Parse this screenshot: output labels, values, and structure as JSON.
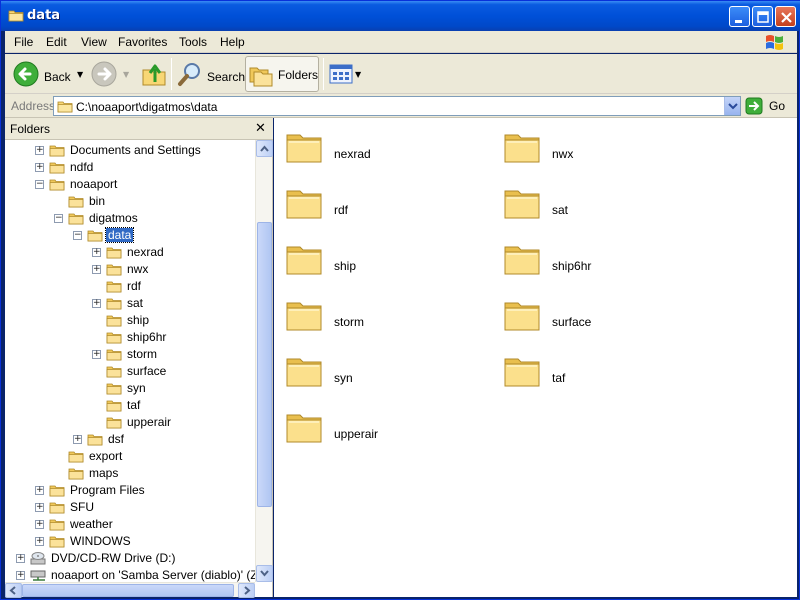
{
  "window": {
    "title": "data",
    "icon": "folder-icon"
  },
  "menu": {
    "items": [
      {
        "label": "File",
        "key": "F"
      },
      {
        "label": "Edit",
        "key": "E"
      },
      {
        "label": "View",
        "key": "V"
      },
      {
        "label": "Favorites",
        "key": "a"
      },
      {
        "label": "Tools",
        "key": "T"
      },
      {
        "label": "Help",
        "key": "H"
      }
    ]
  },
  "toolbar": {
    "back_label": "Back",
    "search_label": "Search",
    "folders_label": "Folders"
  },
  "address": {
    "label": "Address",
    "path": "C:\\noaaport\\digatmos\\data",
    "go_label": "Go"
  },
  "folder_pane": {
    "title": "Folders",
    "close_glyph": "✕",
    "tree": [
      {
        "label": "Documents and Settings",
        "expander": "+"
      },
      {
        "label": "ndfd",
        "expander": "+"
      },
      {
        "label": "noaaport",
        "expander": "−"
      },
      {
        "label": "bin",
        "expander": ""
      },
      {
        "label": "digatmos",
        "expander": "−"
      },
      {
        "label": "data",
        "expander": "−",
        "selected": true
      },
      {
        "label": "nexrad",
        "expander": "+"
      },
      {
        "label": "nwx",
        "expander": "+"
      },
      {
        "label": "rdf",
        "expander": ""
      },
      {
        "label": "sat",
        "expander": "+"
      },
      {
        "label": "ship",
        "expander": ""
      },
      {
        "label": "ship6hr",
        "expander": ""
      },
      {
        "label": "storm",
        "expander": "+"
      },
      {
        "label": "surface",
        "expander": ""
      },
      {
        "label": "syn",
        "expander": ""
      },
      {
        "label": "taf",
        "expander": ""
      },
      {
        "label": "upperair",
        "expander": ""
      },
      {
        "label": "dsf",
        "expander": "+"
      },
      {
        "label": "export",
        "expander": ""
      },
      {
        "label": "maps",
        "expander": ""
      },
      {
        "label": "Program Files",
        "expander": "+"
      },
      {
        "label": "SFU",
        "expander": "+"
      },
      {
        "label": "weather",
        "expander": "+"
      },
      {
        "label": "WINDOWS",
        "expander": "+"
      },
      {
        "label": "DVD/CD-RW Drive (D:)",
        "expander": "+",
        "icon": "dvd-drive-icon"
      },
      {
        "label": "noaaport on 'Samba Server (diablo)' (Z:",
        "expander": "+",
        "icon": "network-drive-icon"
      }
    ]
  },
  "content": {
    "folders": [
      "nexrad",
      "nwx",
      "rdf",
      "sat",
      "ship",
      "ship6hr",
      "storm",
      "surface",
      "syn",
      "taf",
      "upperair"
    ]
  },
  "colors": {
    "titlebar": "#0054e3",
    "selection": "#316ac5",
    "chrome": "#ece9d8",
    "folder": "#f6d77a"
  }
}
